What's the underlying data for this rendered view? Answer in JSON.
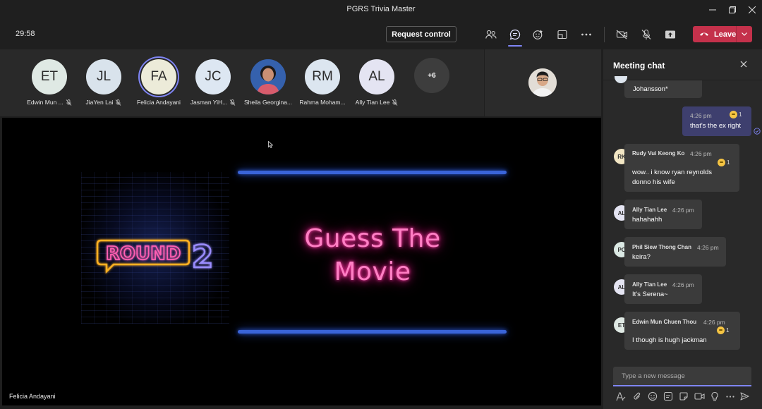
{
  "window": {
    "title": "PGRS Trivia Master"
  },
  "toolbar": {
    "timer": "29:58",
    "request_control_label": "Request control",
    "leave_label": "Leave"
  },
  "participants": [
    {
      "initials": "ET",
      "name": "Edwin Mun ...",
      "color": "#dfe9e4",
      "muted": true
    },
    {
      "initials": "JL",
      "name": "JiaYen Lai",
      "color": "#d9e3ec",
      "muted": true
    },
    {
      "initials": "FA",
      "name": "Felicia Andayani",
      "color": "#ecebd9",
      "muted": false
    },
    {
      "initials": "JC",
      "name": "Jasman YiH...",
      "color": "#dde7f2",
      "muted": true
    },
    {
      "initials": "",
      "name": "Sheila Georgina...",
      "color": "#c46b62",
      "muted": false
    },
    {
      "initials": "RM",
      "name": "Rahma Moham...",
      "color": "#dce6f0",
      "muted": false
    },
    {
      "initials": "AL",
      "name": "Ally Tian Lee",
      "color": "#e4e4f2",
      "muted": true
    }
  ],
  "more_participants": "+6",
  "stage": {
    "presenter": "Felicia Andayani",
    "slide_title_line1": "Guess The",
    "slide_title_line2": "Movie",
    "round_word": "ROUND",
    "round_number": "2"
  },
  "chat": {
    "title": "Meeting chat",
    "truncated_text": "Johansson*",
    "mine": {
      "time": "4:26 pm",
      "text": "that's the ex right",
      "reaction_count": "1"
    },
    "messages": [
      {
        "initials": "RK",
        "avatar_color": "#f2e6c4",
        "author": "Rudy Vui Keong Ko",
        "time": "4:26 pm",
        "line1": "wow.. i know ryan reynolds",
        "line2": "donno his wife",
        "reaction_count": "1",
        "status": "away"
      },
      {
        "initials": "AL",
        "avatar_color": "#e4e4f2",
        "author": "Ally Tian Lee",
        "time": "4:26 pm",
        "line1": "hahahahh",
        "line2": "",
        "reaction_count": "",
        "status": "busy"
      },
      {
        "initials": "PC",
        "avatar_color": "#dbe9e4",
        "author": "Phil Siew Thong Chan",
        "time": "4:26 pm",
        "line1": "keira?",
        "line2": "",
        "reaction_count": "",
        "status": "busy"
      },
      {
        "initials": "AL",
        "avatar_color": "#e4e4f2",
        "author": "Ally Tian Lee",
        "time": "4:26 pm",
        "line1": "It's Serena~",
        "line2": "",
        "reaction_count": "",
        "status": "busy"
      },
      {
        "initials": "ET",
        "avatar_color": "#dfe9e4",
        "author": "Edwin Mun Chuen Thou",
        "time": "4:26 pm",
        "line1": "I though is hugh jackman",
        "line2": "",
        "reaction_count": "1",
        "status": "busy"
      }
    ],
    "compose_placeholder": "Type a new message"
  },
  "colors": {
    "accent": "#7f85f5",
    "leave": "#c4314b",
    "neon_pink": "#ff7fc4",
    "neon_blue": "#3a64d8"
  }
}
